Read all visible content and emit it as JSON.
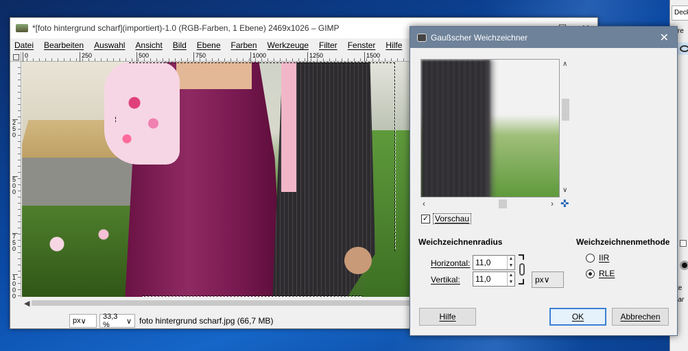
{
  "gimp": {
    "title": "*[foto hintergrund scharf](importiert)-1.0 (RGB-Farben, 1 Ebene) 2469x1026 – GIMP",
    "window_controls": {
      "minimize": "–",
      "maximize": "☐",
      "close": "✕"
    },
    "menu": [
      "Datei",
      "Bearbeiten",
      "Auswahl",
      "Ansicht",
      "Bild",
      "Ebene",
      "Farben",
      "Werkzeuge",
      "Filter",
      "Fenster",
      "Hilfe"
    ],
    "hruler_labels": [
      "0",
      "250",
      "500",
      "750",
      "1000",
      "1250",
      "1500"
    ],
    "vruler_labels": [
      "250",
      "500",
      "750",
      "1000"
    ],
    "status": {
      "unit": "px",
      "zoom": "33,3 %",
      "file": "foto hintergrund scharf.jpg (66,7 MB)"
    }
  },
  "dock": {
    "tab": "Deck",
    "label2": "erre",
    "label3": "itte",
    "label4": "Har"
  },
  "dialog": {
    "title": "Gaußscher Weichzeichner",
    "close": "✕",
    "preview_label": "Vorschau",
    "preview_checked": true,
    "radius_title": "Weichzeichnenradius",
    "horizontal_label": "Horizontal:",
    "horizontal_value": "11,0",
    "vertical_label": "Vertikal:",
    "vertical_value": "11,0",
    "unit": "px",
    "method_title": "Weichzeichnenmethode",
    "methods": [
      {
        "label": "IIR",
        "selected": false
      },
      {
        "label": "RLE",
        "selected": true
      }
    ],
    "buttons": {
      "help": "Hilfe",
      "ok": "OK",
      "cancel": "Abbrechen"
    }
  },
  "colors": {
    "dialog_title_bg": "#6e8299",
    "ok_border": "#3b7fd4",
    "dress": "#8f2a62"
  }
}
